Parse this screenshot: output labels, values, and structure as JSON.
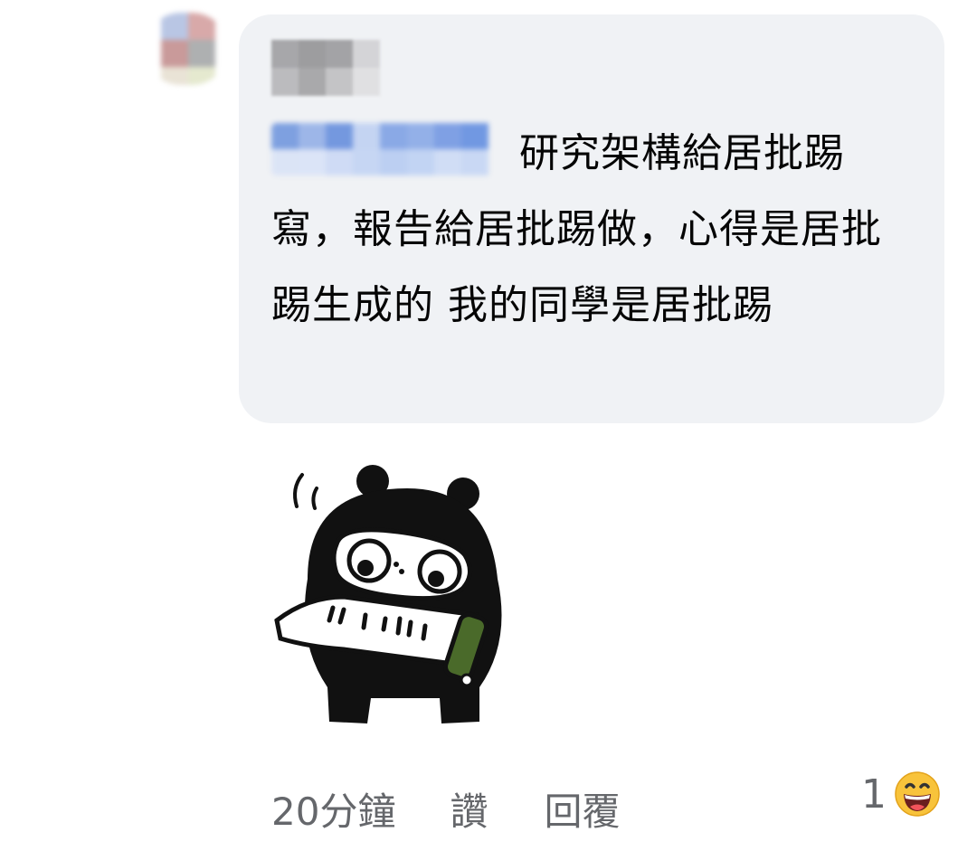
{
  "comment": {
    "author_name": "",
    "mention": "",
    "text": "研究架構給居批踢寫，報告給居批踢做，心得是居批踢生成的 我的同學是居批踢",
    "sticker": "bear-reading-scroll-sticker"
  },
  "actions": {
    "time": "20分鐘",
    "like": "讚",
    "reply": "回覆"
  },
  "reactions": {
    "count": "1",
    "emoji": "grinning-face-icon"
  },
  "colors": {
    "bubble": "#f0f2f5",
    "action_text": "#65676b",
    "text": "#050505"
  }
}
